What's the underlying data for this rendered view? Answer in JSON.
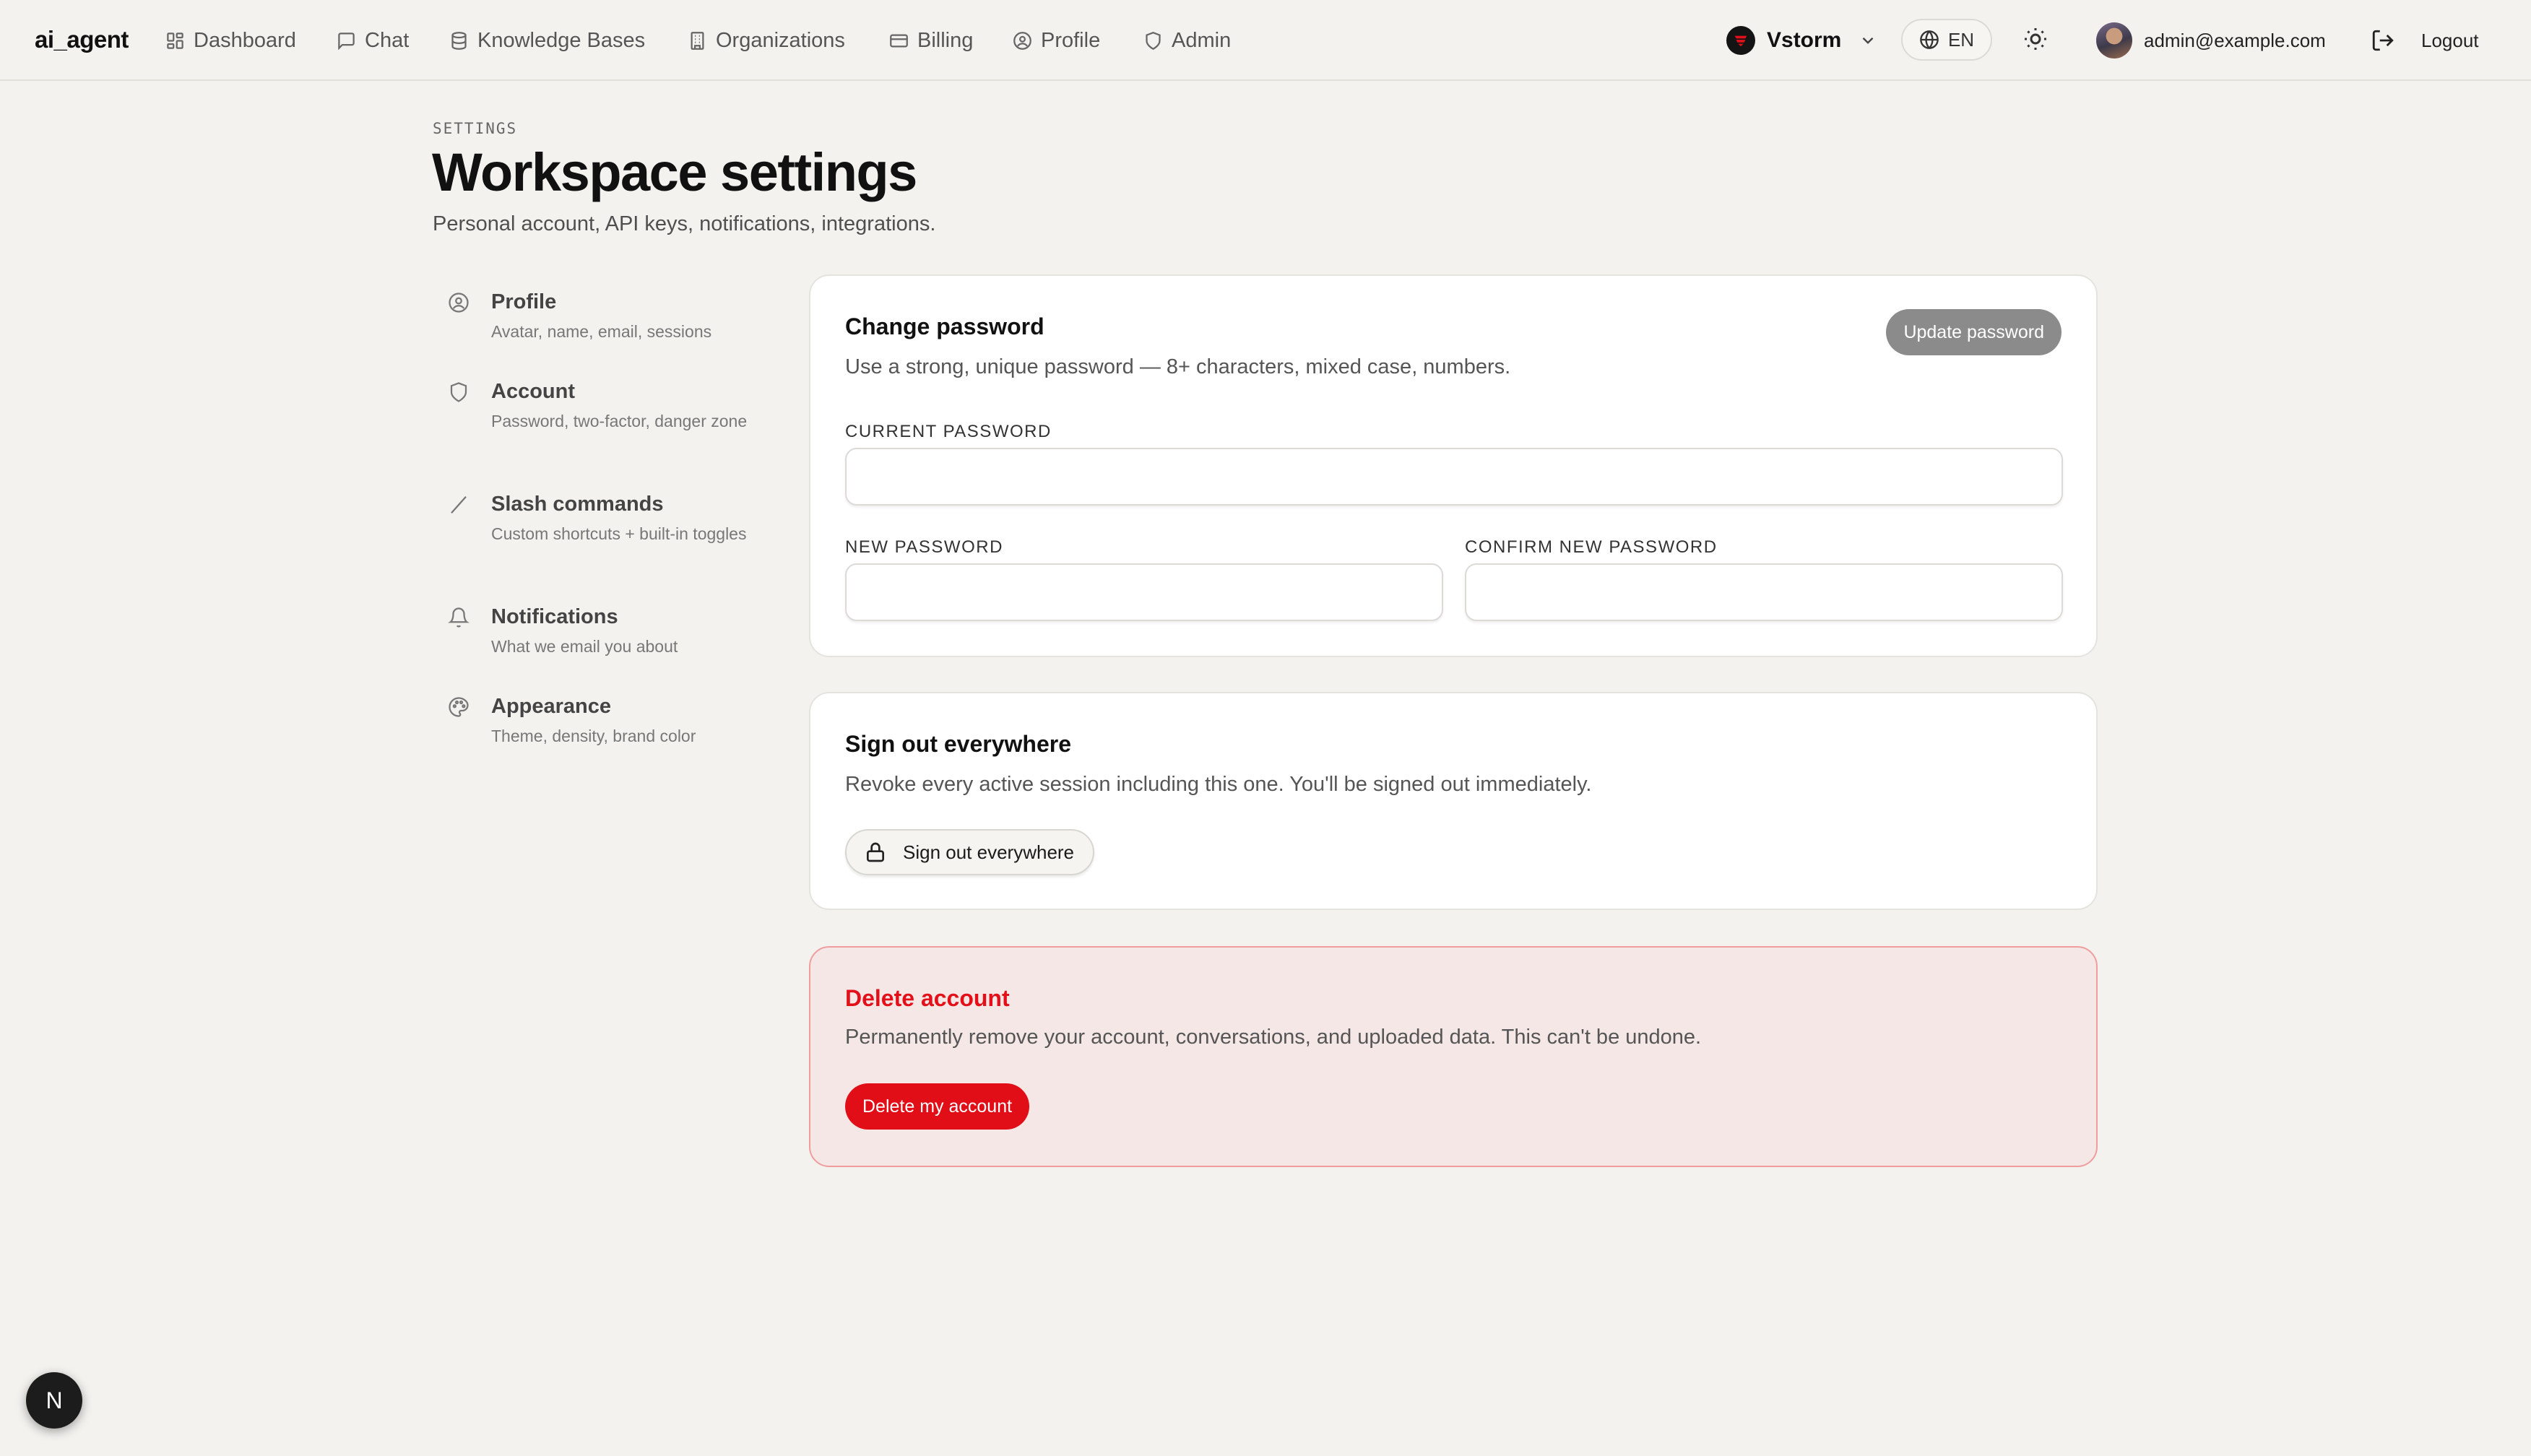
{
  "brand": "ai_agent",
  "nav": {
    "items": [
      {
        "label": "Dashboard",
        "icon": "dashboard-icon"
      },
      {
        "label": "Chat",
        "icon": "chat-icon"
      },
      {
        "label": "Knowledge Bases",
        "icon": "database-icon"
      },
      {
        "label": "Organizations",
        "icon": "building-icon"
      },
      {
        "label": "Billing",
        "icon": "credit-card-icon"
      },
      {
        "label": "Profile",
        "icon": "user-circle-icon"
      },
      {
        "label": "Admin",
        "icon": "shield-icon"
      }
    ],
    "workspace": "Vstorm",
    "language": "EN",
    "user_email": "admin@example.com",
    "logout_label": "Logout"
  },
  "header": {
    "eyebrow": "SETTINGS",
    "title": "Workspace settings",
    "subtitle": "Personal account, API keys, notifications, integrations."
  },
  "sidebar": {
    "items": [
      {
        "label": "Profile",
        "desc": "Avatar, name, email, sessions",
        "icon": "user-circle-icon"
      },
      {
        "label": "Account",
        "desc": "Password, two-factor, danger zone",
        "icon": "shield-icon"
      },
      {
        "label": "Slash commands",
        "desc": "Custom shortcuts + built-in toggles",
        "icon": "slash-icon"
      },
      {
        "label": "Notifications",
        "desc": "What we email you about",
        "icon": "bell-icon"
      },
      {
        "label": "Appearance",
        "desc": "Theme, density, brand color",
        "icon": "palette-icon"
      }
    ]
  },
  "password_card": {
    "title": "Change password",
    "description": "Use a strong, unique password — 8+ characters, mixed case, numbers.",
    "update_label": "Update password",
    "current_label": "CURRENT PASSWORD",
    "new_label": "NEW PASSWORD",
    "confirm_label": "CONFIRM NEW PASSWORD"
  },
  "signout_card": {
    "title": "Sign out everywhere",
    "description": "Revoke every active session including this one. You'll be signed out immediately.",
    "button_label": "Sign out everywhere"
  },
  "delete_card": {
    "title": "Delete account",
    "description": "Permanently remove your account, conversations, and uploaded data. This can't be undone.",
    "button_label": "Delete my account"
  },
  "dev_badge": "N",
  "colors": {
    "background": "#f3f2ef",
    "danger": "#e10d17",
    "danger_bg": "#f4e7e5",
    "muted_button": "#8b8b8b"
  }
}
